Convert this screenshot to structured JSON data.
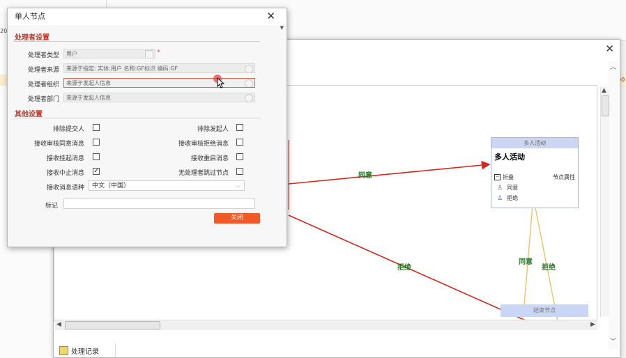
{
  "background": {
    "row_frag_left": "2C",
    "row_frag_right": "00",
    "cell_frag": "20"
  },
  "dialog": {
    "title": "单人节点",
    "section_handler": "处理者设置",
    "section_other": "其他设置",
    "fields": {
      "handler_type": {
        "label": "处理者类型",
        "value": "用户",
        "required_mark": "*"
      },
      "handler_source": {
        "label": "处理者来源",
        "value": "来源于指定: 实体:用户 名称:GF标识 编码:GF"
      },
      "handler_org": {
        "label": "处理者组织",
        "value": "来源于发起人信息"
      },
      "handler_dept": {
        "label": "处理者部门",
        "value": "来源于发起人信息"
      }
    },
    "options": {
      "exclude_submitter": {
        "label": "排除提交人",
        "checked": false
      },
      "exclude_initiator": {
        "label": "排除发起人",
        "checked": false
      },
      "recv_approve_msg": {
        "label": "接收审核同意消息",
        "checked": false
      },
      "recv_reject_msg": {
        "label": "接收审核拒绝消息",
        "checked": false
      },
      "recv_suspend_msg": {
        "label": "接收挂起消息",
        "checked": false
      },
      "recv_restart_msg": {
        "label": "接收重启消息",
        "checked": false
      },
      "recv_abort_msg": {
        "label": "接收中止消息",
        "checked": true
      },
      "no_handler_skip": {
        "label": "无处理者跳过节点",
        "checked": false
      }
    },
    "msg_lang": {
      "label": "接收消息语种",
      "value": "中文（中国）"
    },
    "mark": {
      "label": "标记",
      "value": ""
    },
    "close_button": "关闭",
    "checkmark": "✓"
  },
  "workflow": {
    "multi_node": {
      "header": "多人活动",
      "title": "多人活动",
      "collapse": "折叠",
      "props": "节点属性",
      "items": [
        "同意",
        "拒绝"
      ]
    },
    "end_node": {
      "label": "结束节点"
    },
    "edges": {
      "agree_top": "同意",
      "reject_bottom": "拒绝",
      "agree_right": "同意",
      "reject_right": "拒绝"
    },
    "colors": {
      "edge_red": "#d9261c",
      "edge_yellow": "#e8c46a",
      "label_green": "#2a7a2a"
    }
  },
  "footer": {
    "tab_label": "处理记录"
  }
}
